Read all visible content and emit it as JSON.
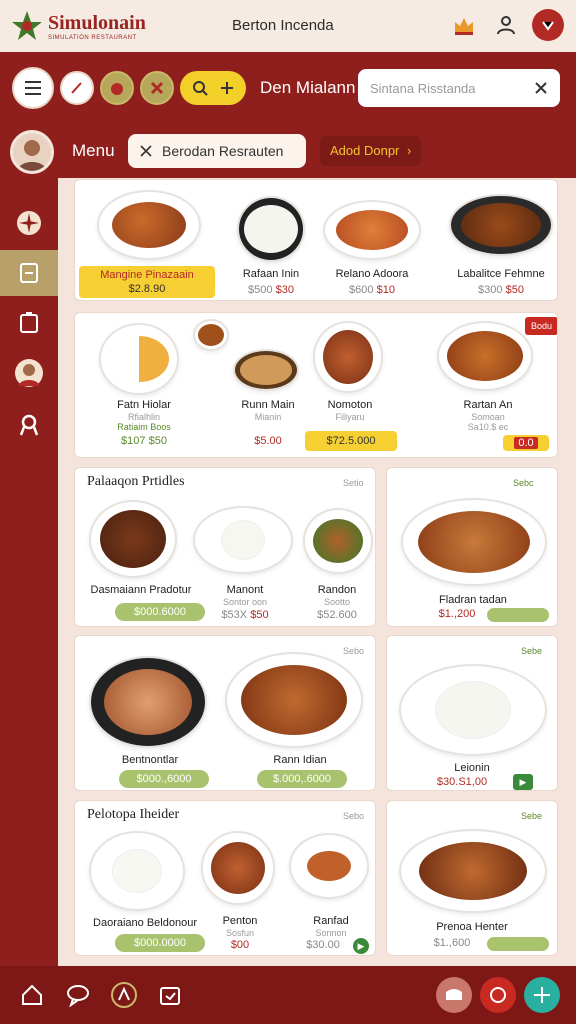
{
  "header": {
    "logo_name": "Simulonain",
    "logo_sub": "SIMULATION RESTAURANT",
    "title": "Berton Incenda"
  },
  "toolbar": {
    "label": "Den Mialann",
    "search_placeholder": "Sintana Risstanda"
  },
  "menu_row": {
    "label": "Menu",
    "filter_chip": "Berodan Resrauten",
    "accent_chip": "Adod Donpr"
  },
  "featured": {
    "items": [
      {
        "name": "Mangine Pinazaain",
        "price": "$2.8.90"
      },
      {
        "name": "Rafaan Inin",
        "price_a": "$500",
        "price_b": "$30"
      },
      {
        "name": "Relano Adoora",
        "price_a": "$600",
        "price_b": "$10"
      },
      {
        "name": "Labalitce Fehmne",
        "price_a": "$300",
        "price_b": "$50"
      }
    ]
  },
  "combos": {
    "badge": "Bodu",
    "items": [
      {
        "name": "Fatn Hiolar",
        "sub": "Rfialhlin",
        "sub2": "Ratiaim Boos",
        "price_a": "$107",
        "price_b": "$50"
      },
      {
        "name": "Runn Main",
        "sub": "Mianin",
        "price": "$5.00"
      },
      {
        "name": "Nomoton",
        "sub": "Filiyaru",
        "price": "$72.5.000"
      },
      {
        "name": "Rartan An",
        "sub": "Somoan",
        "sub2": "Sa10.$ ec",
        "price": "0.0"
      }
    ]
  },
  "section1": {
    "title": "Palaaqon Prtidles",
    "more": "Setio",
    "items": [
      {
        "name": "Dasmaiann Pradotur",
        "price": "$000.6000"
      },
      {
        "name": "Manont",
        "sub": "Sontor oon",
        "price_a": "$53X",
        "price_b": "$50"
      },
      {
        "name": "Randon",
        "sub": "Sootto",
        "price": "$52.600"
      }
    ]
  },
  "side1": {
    "more": "Sebc",
    "name": "Fladran tadan",
    "price": "$1.,200"
  },
  "mid": {
    "more": "Sebo",
    "items": [
      {
        "name": "Bentnontlar",
        "price": "$000.,6000"
      },
      {
        "name": "Rann Idian",
        "price": "$.000,.6000"
      }
    ]
  },
  "side2": {
    "more": "Sebe",
    "name": "Leionin",
    "price": "$30.S1,00"
  },
  "section2": {
    "title": "Pelotopa Iheider",
    "more": "Sebo",
    "items": [
      {
        "name": "Daoraiano Beldonour",
        "price": "$000.0000"
      },
      {
        "name": "Penton",
        "sub": "Sosfun",
        "price": "$00"
      },
      {
        "name": "Ranfad",
        "sub": "Sonnon",
        "price": "$30.00"
      }
    ]
  },
  "side3": {
    "more": "Sebe",
    "name": "Prenoa Henter",
    "price": "$1.,600"
  },
  "colors": {
    "primary": "#8e1f1c",
    "accent": "#f3cf2a",
    "green": "#a9c26e",
    "bg": "#f4e4dc"
  }
}
